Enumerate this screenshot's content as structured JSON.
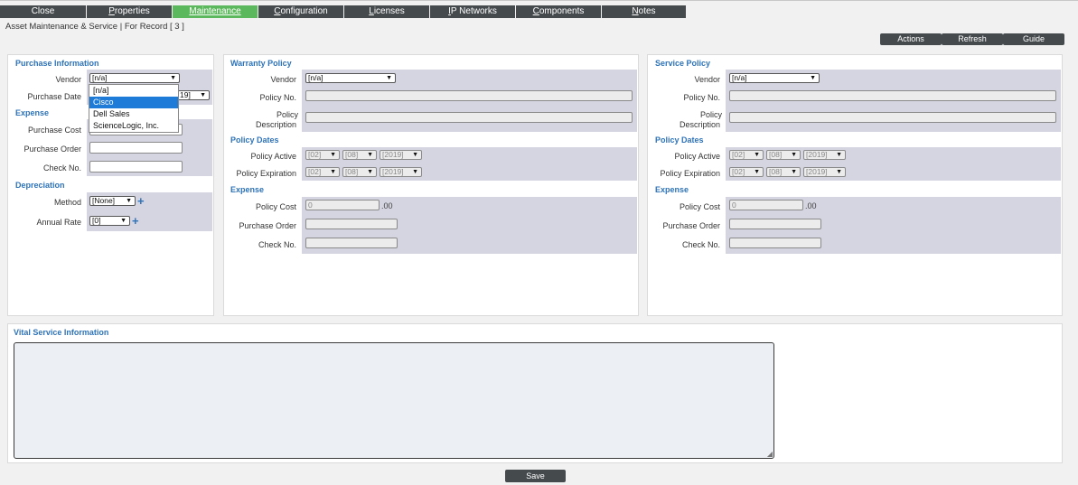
{
  "tabs": [
    {
      "pre": "",
      "u": "",
      "post": "Close"
    },
    {
      "pre": "",
      "u": "P",
      "post": "roperties"
    },
    {
      "pre": "",
      "u": "M",
      "post": "aintenance"
    },
    {
      "pre": "",
      "u": "C",
      "post": "onfiguration"
    },
    {
      "pre": "",
      "u": "L",
      "post": "icenses"
    },
    {
      "pre": "",
      "u": "I",
      "post": "P Networks"
    },
    {
      "pre": "",
      "u": "C",
      "post": "omponents"
    },
    {
      "pre": "",
      "u": "N",
      "post": "otes"
    }
  ],
  "active_tab": "Maintenance",
  "page_title": "Asset Maintenance & Service | For Record [ 3 ]",
  "toolbar": {
    "actions": "Actions",
    "refresh": "Refresh",
    "guide": "Guide"
  },
  "purchase": {
    "title": "Purchase Information",
    "vendor_label": "Vendor",
    "vendor_value": "[n/a]",
    "purchase_date_label": "Purchase Date",
    "purchase_date_year_partial": "19]",
    "vendor_options": [
      "[n/a]",
      "Cisco",
      "Dell Sales",
      "ScienceLogic, Inc."
    ],
    "vendor_highlighted": "Cisco",
    "expense_title": "Expense",
    "purchase_cost_label": "Purchase Cost",
    "purchase_order_label": "Purchase Order",
    "check_no_label": "Check No.",
    "depreciation_title": "Depreciation",
    "method_label": "Method",
    "method_value": "[None]",
    "annual_rate_label": "Annual Rate",
    "annual_rate_value": "[0]"
  },
  "warranty": {
    "title": "Warranty Policy",
    "vendor_label": "Vendor",
    "vendor_value": "[n/a]",
    "policy_no_label": "Policy No.",
    "policy_desc_label_1": "Policy",
    "policy_desc_label_2": "Description",
    "dates_title": "Policy Dates",
    "active_label": "Policy Active",
    "expiration_label": "Policy Expiration",
    "month": "[02]",
    "day": "[08]",
    "year": "[2019]",
    "expense_title": "Expense",
    "policy_cost_label": "Policy Cost",
    "policy_cost_value": "0",
    "cents": ".00",
    "purchase_order_label": "Purchase Order",
    "check_no_label": "Check No."
  },
  "service": {
    "title": "Service Policy",
    "vendor_label": "Vendor",
    "vendor_value": "[n/a]",
    "policy_no_label": "Policy No.",
    "policy_desc_label_1": "Policy",
    "policy_desc_label_2": "Description",
    "dates_title": "Policy Dates",
    "active_label": "Policy Active",
    "expiration_label": "Policy Expiration",
    "month": "[02]",
    "day": "[08]",
    "year": "[2019]",
    "expense_title": "Expense",
    "policy_cost_label": "Policy Cost",
    "policy_cost_value": "0",
    "cents": ".00",
    "purchase_order_label": "Purchase Order",
    "check_no_label": "Check No."
  },
  "vital": {
    "title": "Vital Service Information"
  },
  "save_label": "Save",
  "colors": {
    "tab_bg": "#454a4d",
    "tab_active": "#5cb85c",
    "section_title": "#2e73b8",
    "band": "#d4d5e1",
    "highlight": "#1e7bd7"
  },
  "icons": {
    "plus": "plus-icon",
    "dropdown_arrow": "caret-down-icon"
  }
}
